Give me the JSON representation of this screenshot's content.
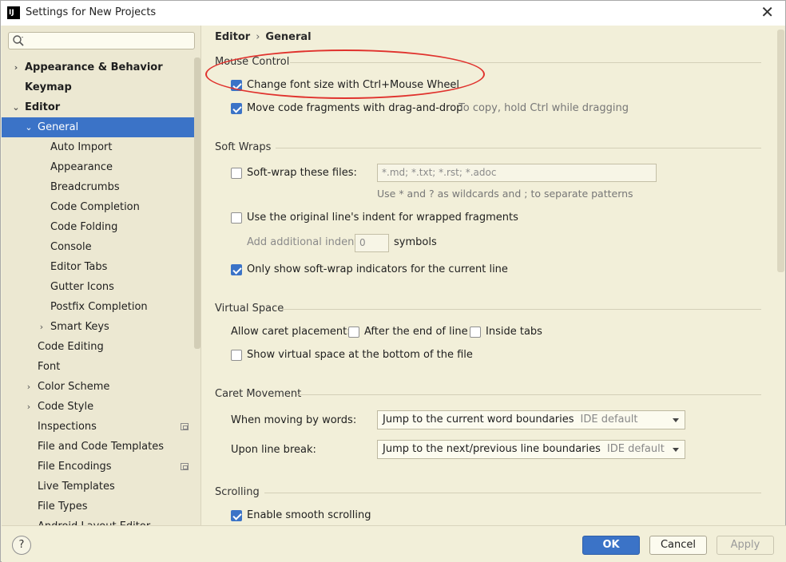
{
  "window": {
    "title": "Settings for New Projects",
    "app_icon": "IJ"
  },
  "sidebar": {
    "search_placeholder": "",
    "items": [
      {
        "label": "Appearance & Behavior",
        "arrow": "›"
      },
      {
        "label": "Keymap"
      },
      {
        "label": "Editor",
        "arrow": "⌄"
      },
      {
        "label": "General",
        "arrow": "⌄"
      },
      {
        "label": "Auto Import"
      },
      {
        "label": "Appearance"
      },
      {
        "label": "Breadcrumbs"
      },
      {
        "label": "Code Completion"
      },
      {
        "label": "Code Folding"
      },
      {
        "label": "Console"
      },
      {
        "label": "Editor Tabs"
      },
      {
        "label": "Gutter Icons"
      },
      {
        "label": "Postfix Completion"
      },
      {
        "label": "Smart Keys",
        "arrow": "›"
      },
      {
        "label": "Code Editing"
      },
      {
        "label": "Font"
      },
      {
        "label": "Color Scheme",
        "arrow": "›"
      },
      {
        "label": "Code Style",
        "arrow": "›"
      },
      {
        "label": "Inspections"
      },
      {
        "label": "File and Code Templates"
      },
      {
        "label": "File Encodings"
      },
      {
        "label": "Live Templates"
      },
      {
        "label": "File Types"
      },
      {
        "label": "Android Layout Editor"
      }
    ]
  },
  "breadcrumb": {
    "first": "Editor",
    "sep": "›",
    "second": "General"
  },
  "mouse_control": {
    "title": "Mouse Control",
    "change_font": "Change font size with Ctrl+Mouse Wheel",
    "move_code": "Move code fragments with drag-and-drop",
    "move_hint": "To copy, hold Ctrl while dragging"
  },
  "soft_wraps": {
    "title": "Soft Wraps",
    "softwrap_files": "Soft-wrap these files:",
    "files_value": "*.md; *.txt; *.rst; *.adoc",
    "files_hint": "Use * and ? as wildcards and ; to separate patterns",
    "original_indent": "Use the original line's indent for wrapped fragments",
    "additional_indent": "Add additional indent:",
    "indent_value": "0",
    "symbols": "symbols",
    "only_show": "Only show soft-wrap indicators for the current line"
  },
  "virtual_space": {
    "title": "Virtual Space",
    "allow_caret": "Allow caret placement:",
    "after_end": "After the end of line",
    "inside_tabs": "Inside tabs",
    "show_virtual": "Show virtual space at the bottom of the file"
  },
  "caret_movement": {
    "title": "Caret Movement",
    "moving_words": "When moving by words:",
    "moving_value": "Jump to the current word boundaries",
    "moving_note": "IDE default",
    "line_break": "Upon line break:",
    "line_value": "Jump to the next/previous line boundaries",
    "line_note": "IDE default"
  },
  "scrolling": {
    "title": "Scrolling",
    "smooth": "Enable smooth scrolling"
  },
  "footer": {
    "help": "?",
    "ok": "OK",
    "cancel": "Cancel",
    "apply": "Apply"
  },
  "colors": {
    "accent": "#3b73c7",
    "background": "#f2efd9",
    "highlight": "#e0322d"
  }
}
